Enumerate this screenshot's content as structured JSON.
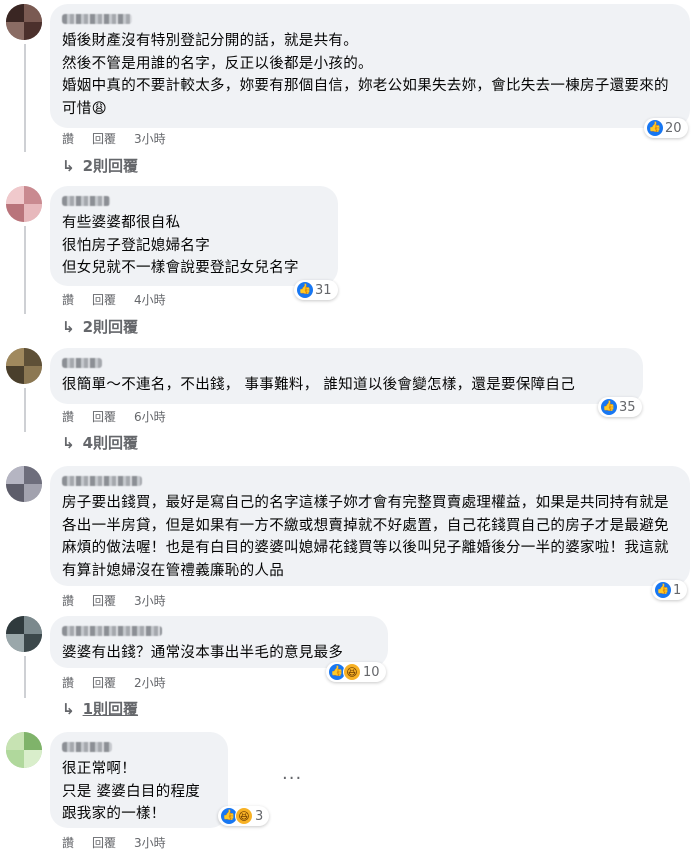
{
  "actions": {
    "like": "讚",
    "reply": "回覆"
  },
  "comments": [
    {
      "text": "婚後財產沒有特別登記分開的話，就是共有。\n然後不管是用誰的名字，反正以後都是小孩的。\n婚姻中真的不要計較太多，妳要有那個自信，妳老公如果失去妳，會比失去一棟房子還要來的可惜😩",
      "reactions": "20",
      "time": "3小時",
      "replies": "2則回覆"
    },
    {
      "text": "有些婆婆都很自私\n很怕房子登記媳婦名字\n但女兒就不一樣會說要登記女兒名字",
      "reactions": "31",
      "time": "4小時",
      "replies": "2則回覆"
    },
    {
      "text": "很簡單～不連名，不出錢， 事事難料， 誰知道以後會變怎樣，還是要保障自己",
      "reactions": "35",
      "time": "6小時",
      "replies": "4則回覆"
    },
    {
      "text": "房子要出錢買，最好是寫自己的名字這樣子妳才會有完整買賣處理權益，如果是共同持有就是各出一半房貸，但是如果有一方不繳或想賣掉就不好處置，自己花錢買自己的房子才是最避免麻煩的做法喔！也是有白目的婆婆叫媳婦花錢買等以後叫兒子離婚後分一半的婆家啦！我這就有算計媳婦沒在管禮義廉恥的人品",
      "reactions": "1",
      "time": "3小時"
    },
    {
      "text": "婆婆有出錢？通常沒本事出半毛的意見最多",
      "reactions": "10",
      "time": "2小時",
      "replies": "1則回覆"
    },
    {
      "text": "很正常啊！\n只是 婆婆白目的程度\n跟我家的一樣！",
      "reactions": "3",
      "time": "3小時",
      "more": "···"
    }
  ],
  "icons": {
    "like": "thumbs-up",
    "haha": "laughing-face",
    "reply_arrow": "reply-arrow",
    "more": "more-options"
  },
  "colors": {
    "like_blue": "#1877f2",
    "bubble_bg": "#f0f2f5",
    "meta_gray": "#65676b"
  }
}
